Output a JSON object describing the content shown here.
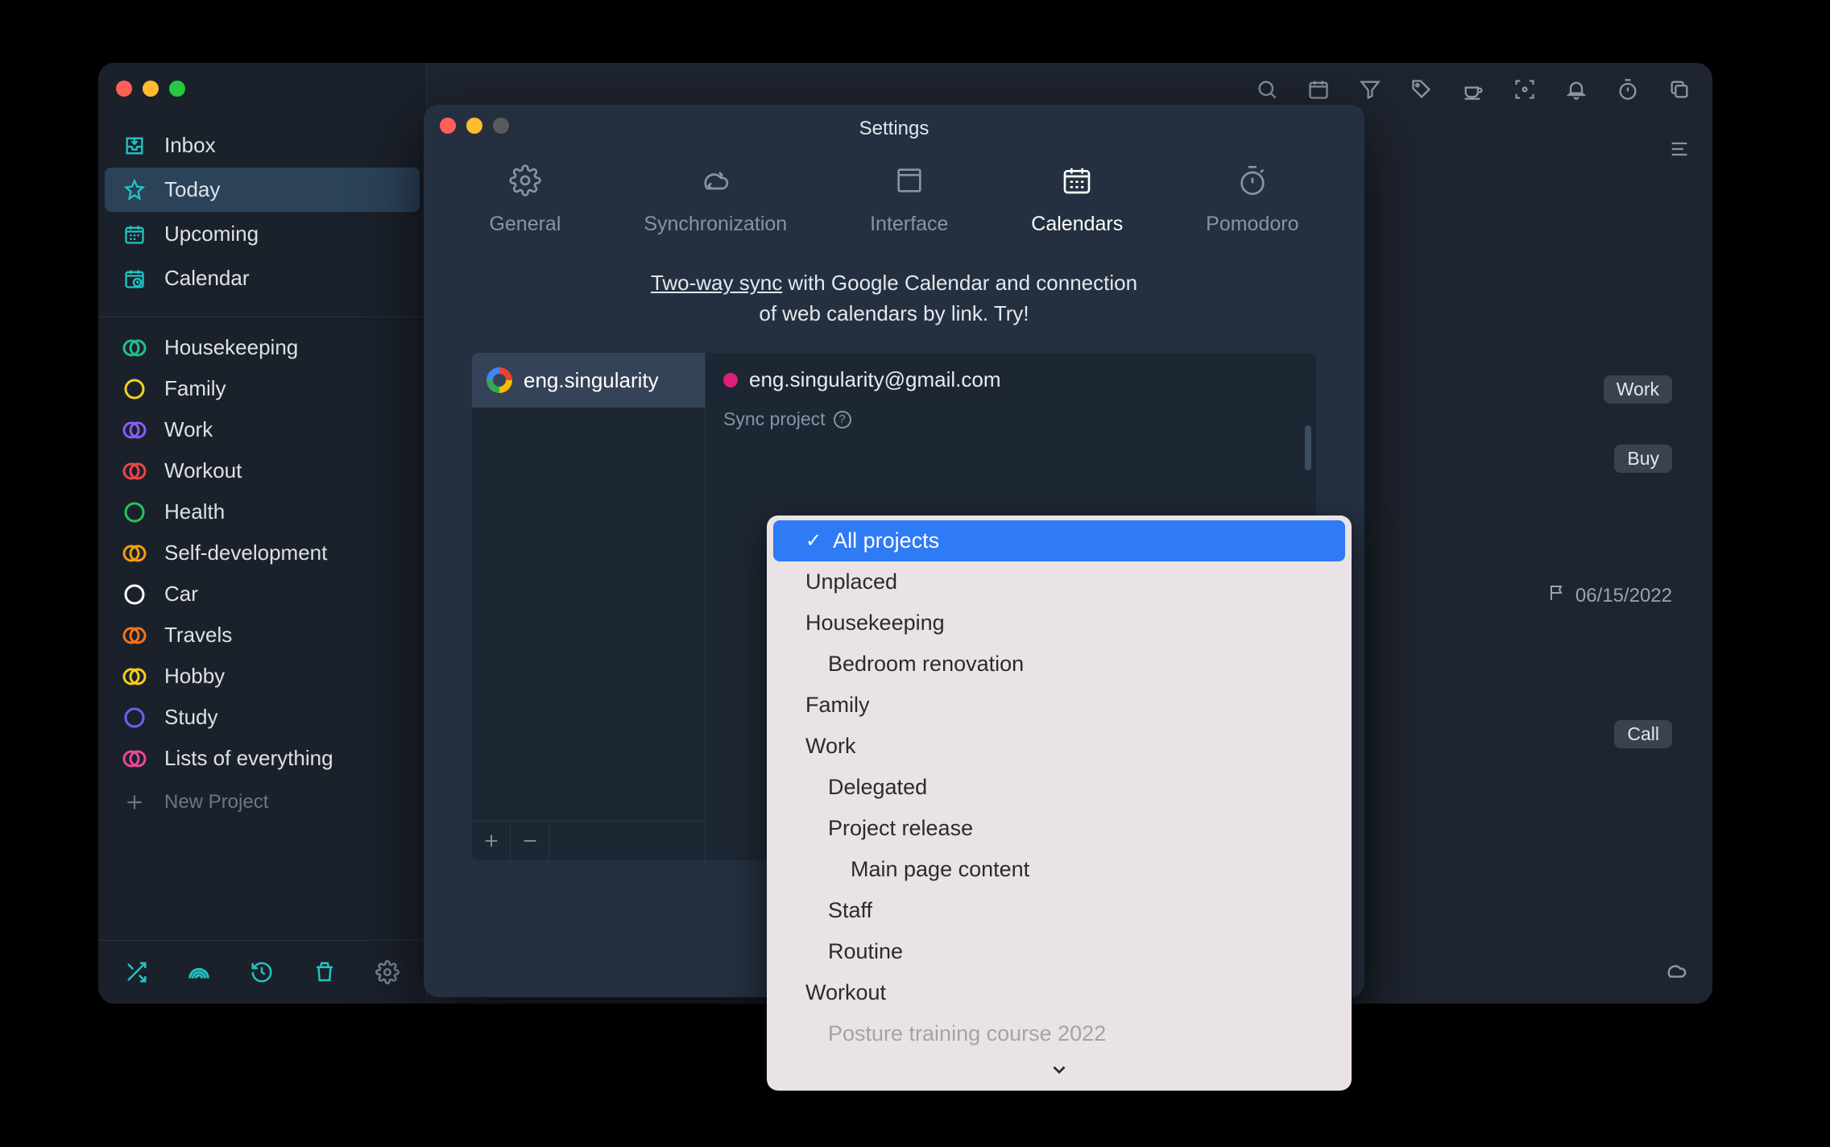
{
  "sidebar": {
    "nav": [
      {
        "label": "Inbox",
        "icon": "inbox"
      },
      {
        "label": "Today",
        "icon": "star",
        "selected": true
      },
      {
        "label": "Upcoming",
        "icon": "calendar-grid"
      },
      {
        "label": "Calendar",
        "icon": "calendar-clock"
      }
    ],
    "projects": [
      {
        "label": "Housekeeping",
        "color1": "#21c08b",
        "color2": "#21c08b"
      },
      {
        "label": "Family",
        "color1": "#f2d21f",
        "color2": "#f2d21f",
        "single": true
      },
      {
        "label": "Work",
        "color1": "#8b5cf6",
        "color2": "#8b5cf6"
      },
      {
        "label": "Workout",
        "color1": "#ef4444",
        "color2": "#ef4444"
      },
      {
        "label": "Health",
        "color1": "#22c55e",
        "color2": "#22c55e",
        "single": true
      },
      {
        "label": "Self-development",
        "color1": "#f59e0b",
        "color2": "#f59e0b"
      },
      {
        "label": "Car",
        "color1": "#ffffff",
        "color2": "#ffffff",
        "single": true
      },
      {
        "label": "Travels",
        "color1": "#f97316",
        "color2": "#f97316"
      },
      {
        "label": "Hobby",
        "color1": "#facc15",
        "color2": "#facc15"
      },
      {
        "label": "Study",
        "color1": "#6366f1",
        "color2": "#6366f1",
        "single": true
      },
      {
        "label": "Lists of everything",
        "color1": "#ec4899",
        "color2": "#ec4899"
      }
    ],
    "new_project": "New Project"
  },
  "main": {
    "tags": [
      {
        "label": "Work"
      },
      {
        "label": "Buy"
      },
      {
        "label": "Call"
      }
    ],
    "date": "06/15/2022"
  },
  "settings": {
    "title": "Settings",
    "tabs": [
      {
        "label": "General",
        "icon": "gear"
      },
      {
        "label": "Synchronization",
        "icon": "cloud-sync"
      },
      {
        "label": "Interface",
        "icon": "window"
      },
      {
        "label": "Calendars",
        "icon": "calendar",
        "active": true
      },
      {
        "label": "Pomodoro",
        "icon": "timer"
      }
    ],
    "blurb_link": "Two-way sync",
    "blurb_rest_1": " with Google Calendar and connection",
    "blurb_rest_2": "of web calendars by link. Try!",
    "account_short": "eng.singularity",
    "account_email": "eng.singularity@gmail.com",
    "sync_project_label": "Sync project"
  },
  "dropdown": {
    "selected": "All projects",
    "items": [
      {
        "label": "Unplaced",
        "level": 0
      },
      {
        "label": "Housekeeping",
        "level": 0
      },
      {
        "label": "Bedroom renovation",
        "level": 1
      },
      {
        "label": "Family",
        "level": 0
      },
      {
        "label": "Work",
        "level": 0
      },
      {
        "label": "Delegated",
        "level": 1
      },
      {
        "label": "Project release",
        "level": 1
      },
      {
        "label": "Main page content",
        "level": 2
      },
      {
        "label": "Staff",
        "level": 1
      },
      {
        "label": "Routine",
        "level": 1
      },
      {
        "label": "Workout",
        "level": 0
      },
      {
        "label": "Posture training course 2022",
        "level": 1,
        "faded": true
      }
    ]
  }
}
